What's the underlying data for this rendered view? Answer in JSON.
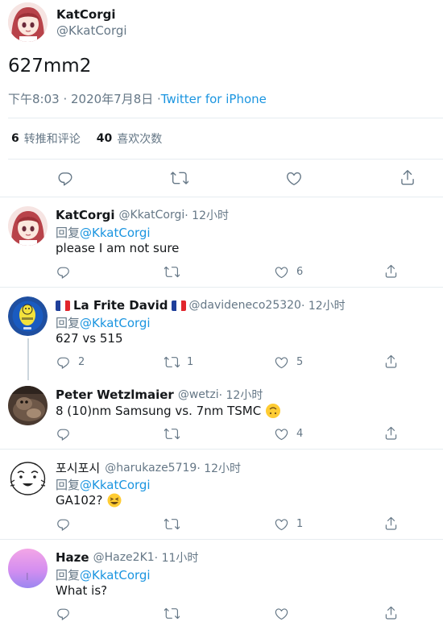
{
  "main": {
    "author_name": "KatCorgi",
    "author_handle": "@KkatCorgi",
    "text": "627mm2",
    "time": "下午8:03 · 2020年7月8日 · ",
    "source": "Twitter for iPhone",
    "retweets_count": "6",
    "retweets_label": "转推和评论",
    "likes_count": "40",
    "likes_label": "喜欢次数"
  },
  "replies": [
    {
      "name": "KatCorgi",
      "handle": "@KkatCorgi",
      "time": " · 12小时",
      "reply_prefix": "回复 ",
      "reply_to": "@KkatCorgi",
      "text": "please I am not sure",
      "reply_count": "",
      "retweet_count": "",
      "like_count": "6"
    },
    {
      "name": "La Frite David",
      "handle": "@davideneco25320",
      "time": " · 12小时",
      "reply_prefix": "回复 ",
      "reply_to": "@KkatCorgi",
      "text": "627 vs 515",
      "reply_count": "2",
      "retweet_count": "1",
      "like_count": "5"
    },
    {
      "name": "Peter Wetzlmaier",
      "handle": "@wetzi",
      "time": " · 12小时",
      "reply_prefix": "",
      "reply_to": "",
      "text": "8 (10)nm Samsung vs. 7nm TSMC",
      "reply_count": "",
      "retweet_count": "",
      "like_count": "4"
    },
    {
      "name": "포시포시",
      "handle": "@harukaze5719",
      "time": " · 12小时",
      "reply_prefix": "回复 ",
      "reply_to": "@KkatCorgi",
      "text": "GA102?",
      "reply_count": "",
      "retweet_count": "",
      "like_count": "1"
    },
    {
      "name": "Haze",
      "handle": "@Haze2K1",
      "time": " · 11小时",
      "reply_prefix": "回复 ",
      "reply_to": "@KkatCorgi",
      "text": "What is?",
      "reply_count": "",
      "retweet_count": "",
      "like_count": ""
    }
  ],
  "icons": {
    "reply": "reply-icon",
    "retweet": "retweet-icon",
    "like": "heart-icon",
    "share": "share-icon"
  },
  "colors": {
    "link": "#1b95e0",
    "secondary": "#657786",
    "divider": "#e6ecf0",
    "action_icon": "#657786"
  }
}
